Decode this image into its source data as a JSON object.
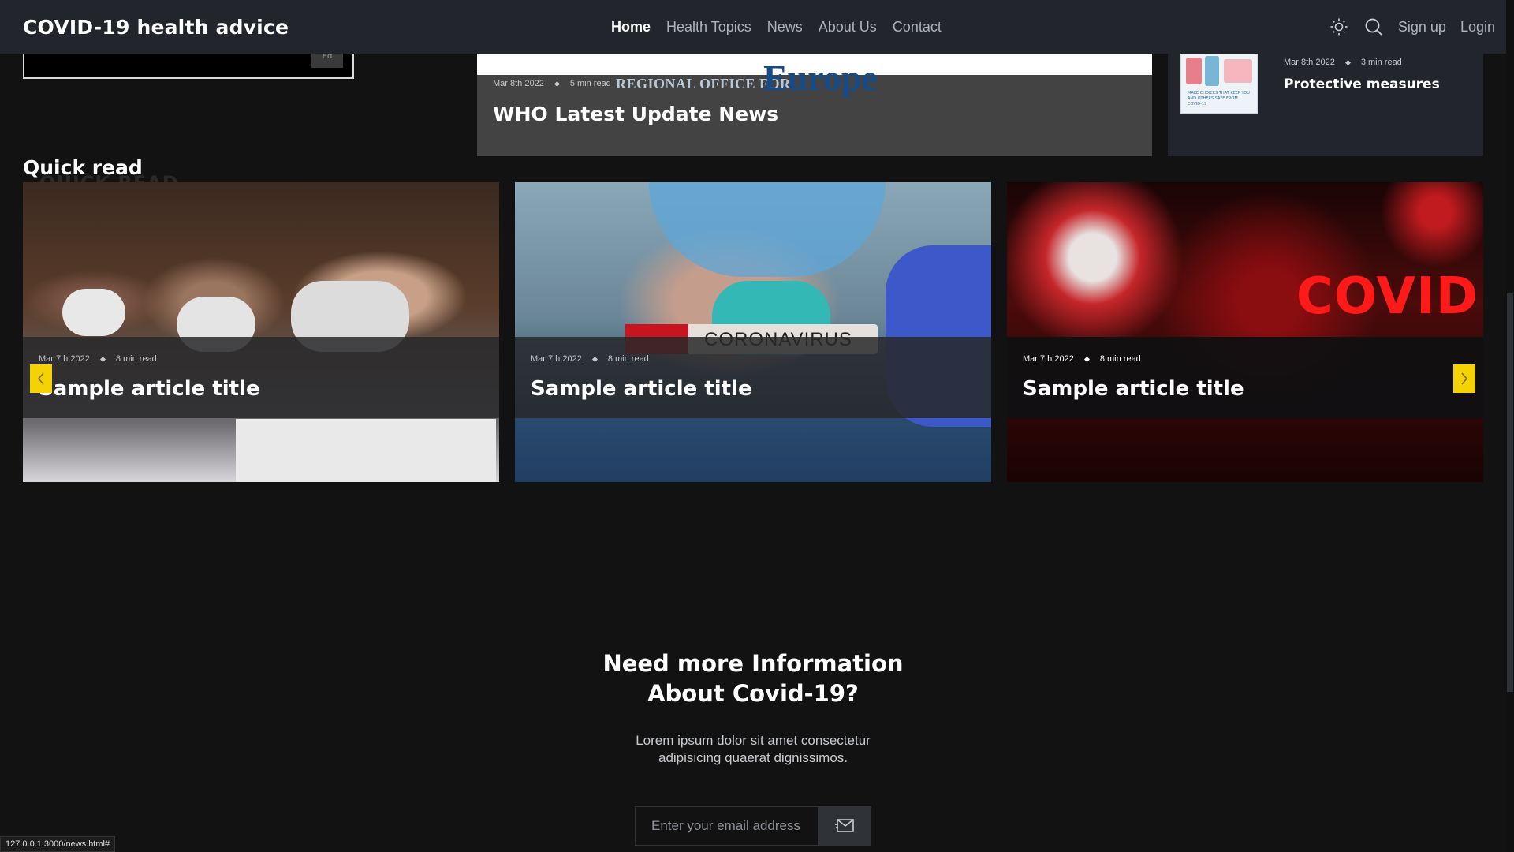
{
  "header": {
    "brand": "COVID-19 health advice",
    "nav": [
      "Home",
      "Health Topics",
      "News",
      "About Us",
      "Contact"
    ],
    "active_nav": "Home",
    "icons": [
      "sun-icon",
      "search-icon"
    ],
    "signup": "Sign up",
    "login": "Login"
  },
  "top": {
    "left_card": {
      "badge": "Ed"
    },
    "featured": {
      "image_text_small": "REGIONAL OFFICE FOR",
      "image_text_big": "Europe",
      "date": "Mar 8th 2022",
      "read_time": "5 min read",
      "title": "WHO Latest Update News"
    },
    "side": {
      "thumb_text": "MAKE CHOICES THAT KEEP YOU AND OTHERS SAFE FROM COVID-19",
      "date": "Mar 8th 2022",
      "read_time": "3 min read",
      "title": "Protective measures"
    }
  },
  "quick_read": {
    "title": "Quick read",
    "ghost": "QUICK READ",
    "cards": [
      {
        "date": "Mar 7th 2022",
        "read_time": "8 min read",
        "title": "Sample article title"
      },
      {
        "date": "Mar 7th 2022",
        "read_time": "8 min read",
        "title": "Sample article title",
        "image_text": "CORONAVIRUS"
      },
      {
        "date": "Mar 7th 2022",
        "read_time": "8 min read",
        "title": "Sample article title",
        "image_text": "COVID"
      }
    ]
  },
  "cta": {
    "title_line1": "Need more Information",
    "title_line2": "About Covid-19?",
    "text_line1": "Lorem ipsum dolor sit amet consectetur",
    "text_line2": "adipisicing quaerat dignissimos.",
    "email_placeholder": "Enter your email address"
  },
  "status_url": "127.0.0.1:3000/news.html#",
  "colors": {
    "accent": "#f5d300",
    "nav_bg": "#22252b",
    "page_bg": "#121212"
  }
}
